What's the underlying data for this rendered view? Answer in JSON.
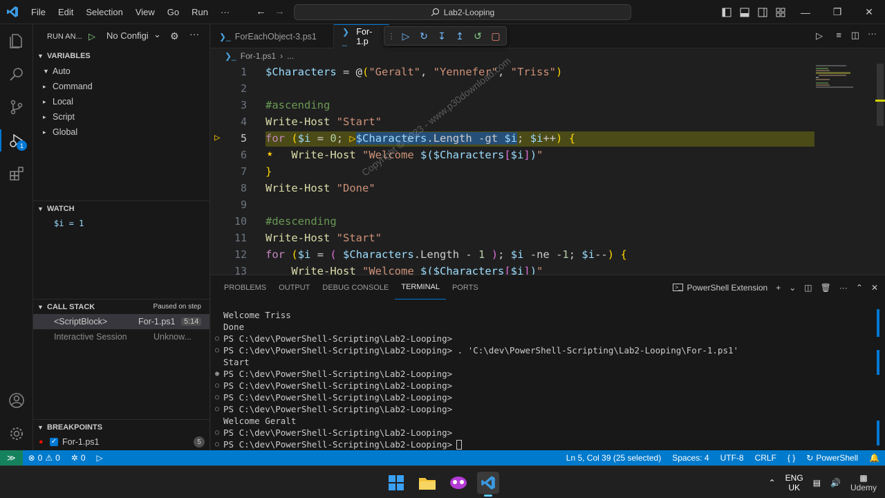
{
  "titlebar": {
    "menu": [
      "File",
      "Edit",
      "Selection",
      "View",
      "Go",
      "Run",
      "···"
    ],
    "search_text": "Lab2-Looping"
  },
  "sidebar": {
    "run_label": "RUN AN...",
    "config_label": "No Configi",
    "variables_title": "VARIABLES",
    "variable_groups": [
      "Auto",
      "Command",
      "Local",
      "Script",
      "Global"
    ],
    "watch_title": "WATCH",
    "watch_items": [
      "$i = 1"
    ],
    "callstack_title": "CALL STACK",
    "callstack_status": "Paused on step",
    "callstack_items": [
      {
        "name": "<ScriptBlock>",
        "file": "For-1.ps1",
        "pos": "5:14"
      },
      {
        "name": "Interactive Session",
        "file": "Unknow..."
      }
    ],
    "breakpoints_title": "BREAKPOINTS",
    "breakpoints": [
      {
        "file": "For-1.ps1",
        "line": "5"
      }
    ]
  },
  "editor": {
    "tabs": [
      {
        "label": "ForEachObject-3.ps1",
        "active": false
      },
      {
        "label": "For-1.p",
        "active": true
      }
    ],
    "breadcrumb": [
      "For-1.ps1",
      "..."
    ],
    "line_numbers": [
      "1",
      "2",
      "3",
      "4",
      "5",
      "6",
      "7",
      "8",
      "9",
      "10",
      "11",
      "12",
      "13"
    ]
  },
  "panel": {
    "tabs": [
      "PROBLEMS",
      "OUTPUT",
      "DEBUG CONSOLE",
      "TERMINAL",
      "PORTS"
    ],
    "active_tab": "TERMINAL",
    "shell_label": "PowerShell Extension",
    "terminal_lines": [
      {
        "dot": "",
        "text": "Welcome Triss"
      },
      {
        "dot": "",
        "text": "Done"
      },
      {
        "dot": "○",
        "text": "PS C:\\dev\\PowerShell-Scripting\\Lab2-Looping>"
      },
      {
        "dot": "○",
        "text": "PS C:\\dev\\PowerShell-Scripting\\Lab2-Looping> . 'C:\\dev\\PowerShell-Scripting\\Lab2-Looping\\For-1.ps1'"
      },
      {
        "dot": "",
        "text": "Start"
      },
      {
        "dot": "●",
        "text": "PS C:\\dev\\PowerShell-Scripting\\Lab2-Looping>"
      },
      {
        "dot": "○",
        "text": "PS C:\\dev\\PowerShell-Scripting\\Lab2-Looping>"
      },
      {
        "dot": "○",
        "text": "PS C:\\dev\\PowerShell-Scripting\\Lab2-Looping>"
      },
      {
        "dot": "○",
        "text": "PS C:\\dev\\PowerShell-Scripting\\Lab2-Looping>"
      },
      {
        "dot": "",
        "text": "Welcome Geralt"
      },
      {
        "dot": "○",
        "text": "PS C:\\dev\\PowerShell-Scripting\\Lab2-Looping>"
      },
      {
        "dot": "○",
        "text": "PS C:\\dev\\PowerShell-Scripting\\Lab2-Looping>"
      }
    ]
  },
  "statusbar": {
    "errors": "0",
    "warnings": "0",
    "ports": "0",
    "cursor": "Ln 5, Col 39 (25 selected)",
    "spaces": "Spaces: 4",
    "encoding": "UTF-8",
    "eol": "CRLF",
    "language": "PowerShell"
  },
  "taskbar": {
    "lang": "ENG",
    "region": "UK",
    "brand": "Udemy"
  },
  "watermark": "Copyright © 2023 - www.p30download.com",
  "colors": {
    "accent": "#0078d4",
    "statusbar": "#007acc",
    "debug_line": "#4b4b18"
  }
}
